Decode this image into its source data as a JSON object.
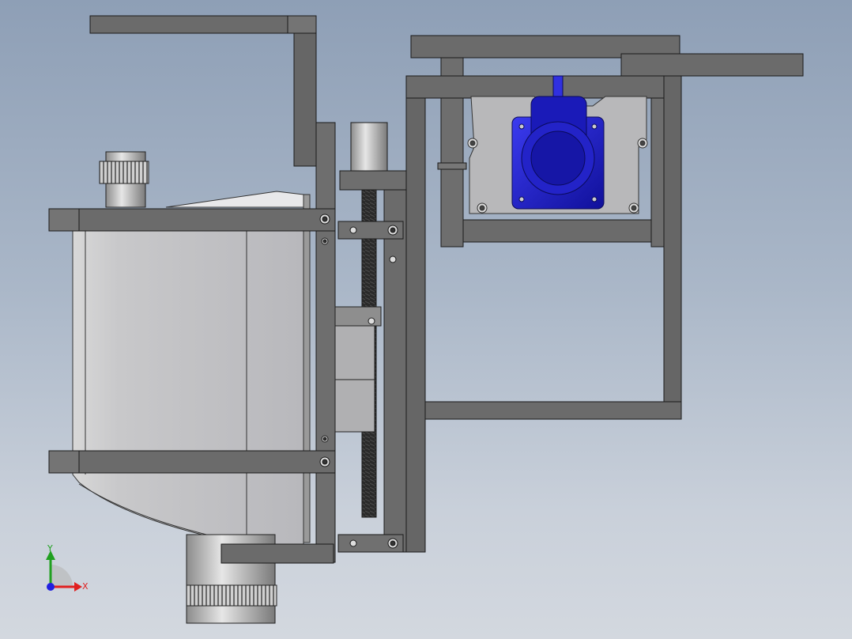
{
  "window": {
    "title": ""
  },
  "viewport": {
    "background_top": "#8e9fb6",
    "background_bottom": "#d3d8df",
    "model": {
      "part_color": "#6b6b6b",
      "edge_color": "#1a1a1a",
      "housing_color": "#c4c4c6",
      "motor_color": "#1f1fd0"
    }
  },
  "triad": {
    "x_label": "X",
    "y_label": "Y",
    "x_color": "#e02020",
    "y_color": "#20a020",
    "z_color": "#2020e0"
  }
}
